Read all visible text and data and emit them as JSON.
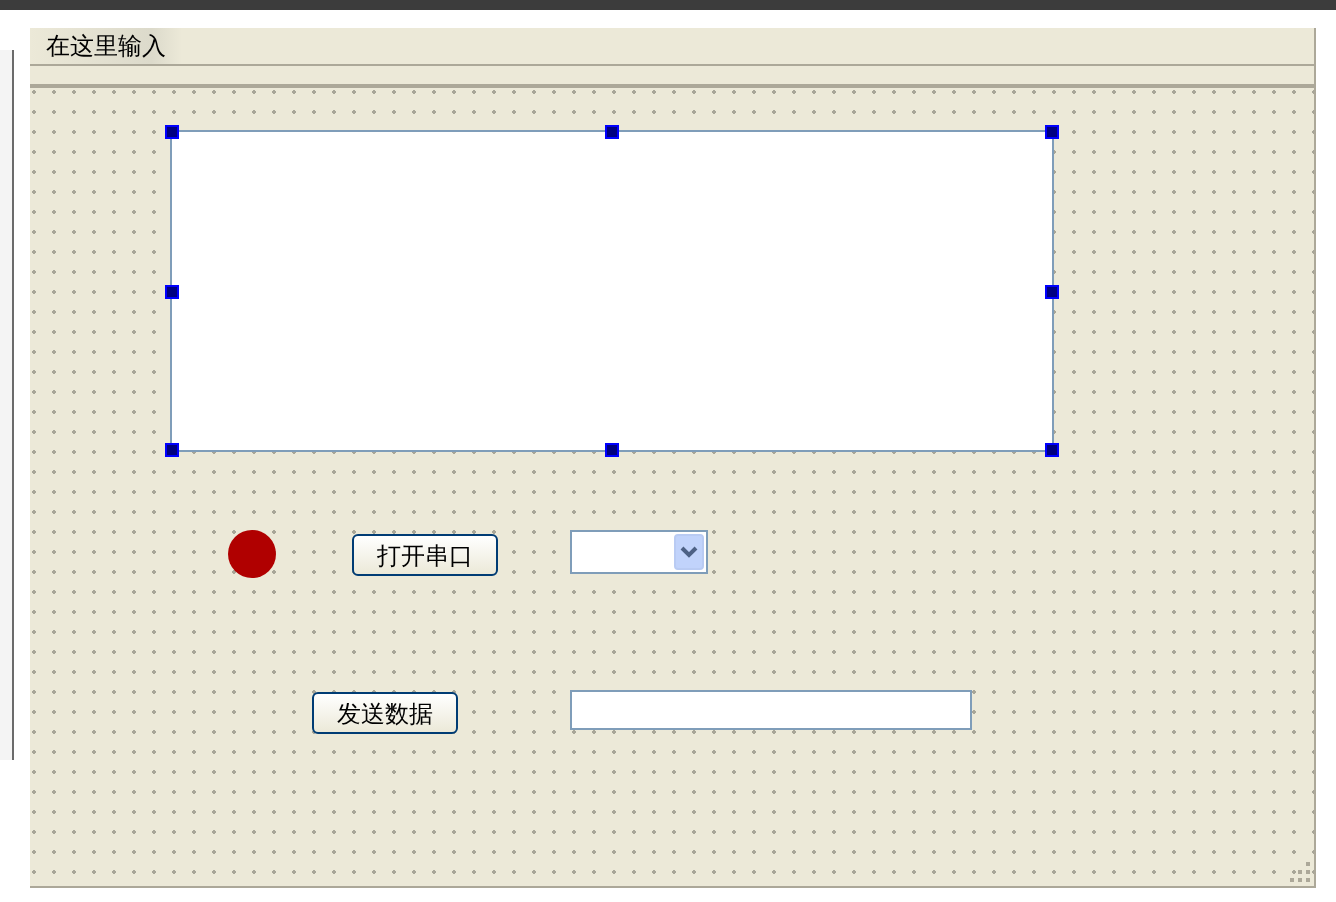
{
  "menu_bar": {
    "items": [
      {
        "label": "在这里输入",
        "selected": true
      }
    ]
  },
  "form": {
    "text_edit": {
      "selected": true
    },
    "indicator": {
      "color": "#b00000"
    },
    "open_port_button": {
      "label": "打开串口"
    },
    "send_button": {
      "label": "发送数据"
    }
  }
}
